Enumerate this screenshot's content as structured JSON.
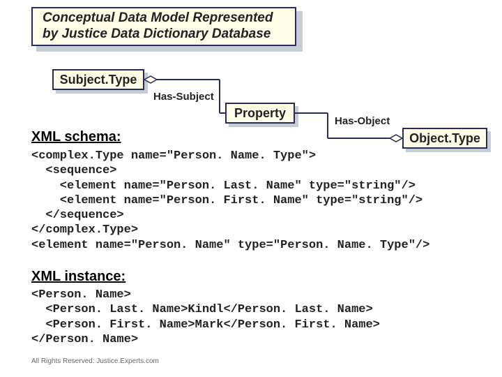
{
  "title": {
    "line1": "Conceptual Data Model Represented",
    "line2": "by Justice Data Dictionary Database"
  },
  "nodes": {
    "subject": "Subject.Type",
    "property": "Property",
    "object": "Object.Type"
  },
  "relations": {
    "hasSubject": "Has-Subject",
    "hasObject": "Has-Object"
  },
  "sections": {
    "xmlSchemaHeading": "XML schema:",
    "xmlInstanceHeading": "XML instance:"
  },
  "xmlSchema": "<complex.Type name=\"Person. Name. Type\">\n  <sequence>\n    <element name=\"Person. Last. Name\" type=\"string\"/>\n    <element name=\"Person. First. Name\" type=\"string\"/>\n  </sequence>\n</complex.Type>\n<element name=\"Person. Name\" type=\"Person. Name. Type\"/>",
  "xmlInstance": "<Person. Name>\n  <Person. Last. Name>Kindl</Person. Last. Name>\n  <Person. First. Name>Mark</Person. First. Name>\n</Person. Name>",
  "footer": "All Rights Reserved: Justice.Experts.com"
}
